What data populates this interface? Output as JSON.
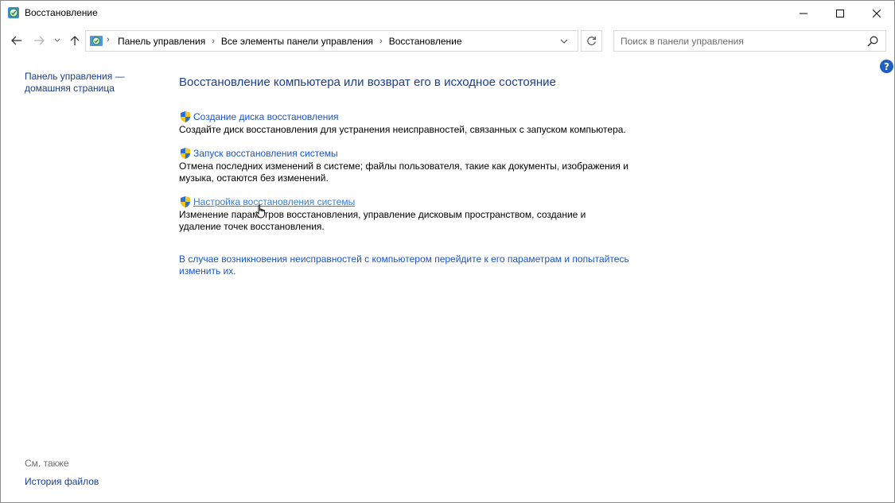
{
  "window": {
    "title": "Восстановление"
  },
  "address": {
    "crumbs": [
      "Панель управления",
      "Все элементы панели управления",
      "Восстановление"
    ]
  },
  "search": {
    "placeholder": "Поиск в панели управления"
  },
  "left_pane": {
    "home_link": "Панель управления — домашняя страница",
    "see_also_label": "См. также",
    "file_history_link": "История файлов"
  },
  "main": {
    "title": "Восстановление компьютера или возврат его в исходное состояние",
    "tasks": [
      {
        "link": "Создание диска восстановления",
        "description": "Создайте диск восстановления для устранения неисправностей, связанных с запуском компьютера."
      },
      {
        "link": "Запуск восстановления системы",
        "description": "Отмена последних изменений в системе; файлы пользователя, такие как документы, изображения и музыка, остаются без изменений."
      },
      {
        "link": "Настройка восстановления системы",
        "description": "Изменение параметров восстановления, управление дисковым пространством, создание и удаление точек восстановления."
      }
    ],
    "troubleshoot_link": "В случае возникновения неисправностей с компьютером перейдите к его параметрам и попытайтесь изменить их."
  },
  "help_label": "?",
  "colors": {
    "link": "#1a55c4",
    "link_hover": "#3b7fd6",
    "title": "#1e3d8a",
    "nav_link": "#1a3e8a"
  }
}
